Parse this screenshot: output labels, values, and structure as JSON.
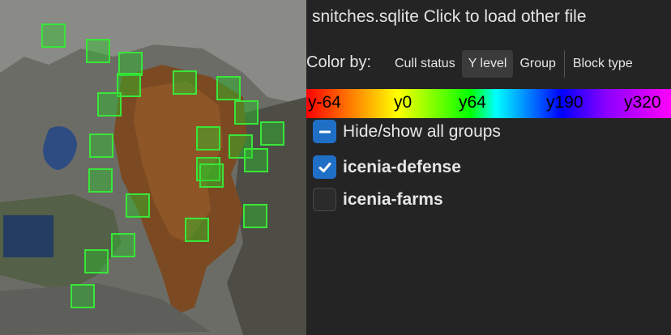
{
  "file_bar": {
    "title": "snitches.sqlite Click to load other file"
  },
  "color_by": {
    "label": "Color by:",
    "tabs": [
      {
        "label": "Cull status",
        "active": false
      },
      {
        "label": "Y level",
        "active": true
      },
      {
        "label": "Group",
        "active": false
      },
      {
        "label": "Block type",
        "active": false
      }
    ]
  },
  "gradient": {
    "labels": [
      "y-64",
      "y0",
      "y64",
      "y190",
      "y320"
    ]
  },
  "groups": {
    "toggle_all": {
      "label": "Hide/show all groups",
      "state": "partial"
    },
    "items": [
      {
        "label": "icenia-defense",
        "checked": true
      },
      {
        "label": "icenia-farms",
        "checked": false
      }
    ]
  },
  "colors": {
    "accent": "#1f6fc7",
    "snitch_border": "#39e639",
    "panel_bg": "#242424"
  },
  "icons": {
    "check": "checkmark-icon",
    "minus": "minus-icon"
  }
}
